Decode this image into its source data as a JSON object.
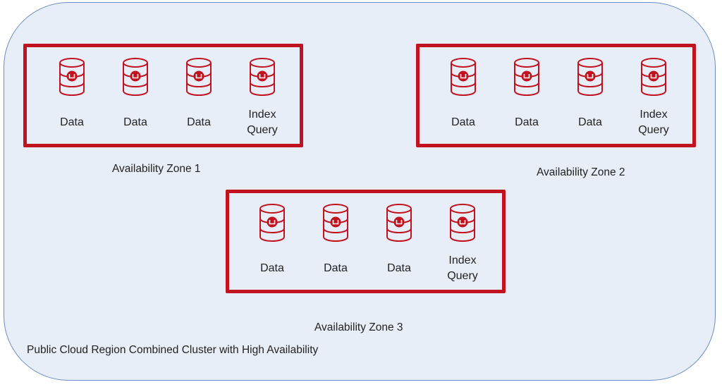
{
  "diagram": {
    "region_label": "Public Cloud Region Combined Cluster with High Availability",
    "colors": {
      "region_fill": "#e8eef8",
      "region_border": "#6b8cc6",
      "zone_border": "#c1121f",
      "icon": "#c1121f"
    },
    "zones": [
      {
        "label": "Availability Zone 1",
        "nodes": [
          {
            "icon": "database-icon",
            "label": "Data"
          },
          {
            "icon": "database-icon",
            "label": "Data"
          },
          {
            "icon": "database-icon",
            "label": "Data"
          },
          {
            "icon": "database-icon",
            "label_line1": "Index",
            "label_line2": "Query"
          }
        ]
      },
      {
        "label": "Availability Zone 2",
        "nodes": [
          {
            "icon": "database-icon",
            "label": "Data"
          },
          {
            "icon": "database-icon",
            "label": "Data"
          },
          {
            "icon": "database-icon",
            "label": "Data"
          },
          {
            "icon": "database-icon",
            "label_line1": "Index",
            "label_line2": "Query"
          }
        ]
      },
      {
        "label": "Availability Zone 3",
        "nodes": [
          {
            "icon": "database-icon",
            "label": "Data"
          },
          {
            "icon": "database-icon",
            "label": "Data"
          },
          {
            "icon": "database-icon",
            "label": "Data"
          },
          {
            "icon": "database-icon",
            "label_line1": "Index",
            "label_line2": "Query"
          }
        ]
      }
    ]
  }
}
